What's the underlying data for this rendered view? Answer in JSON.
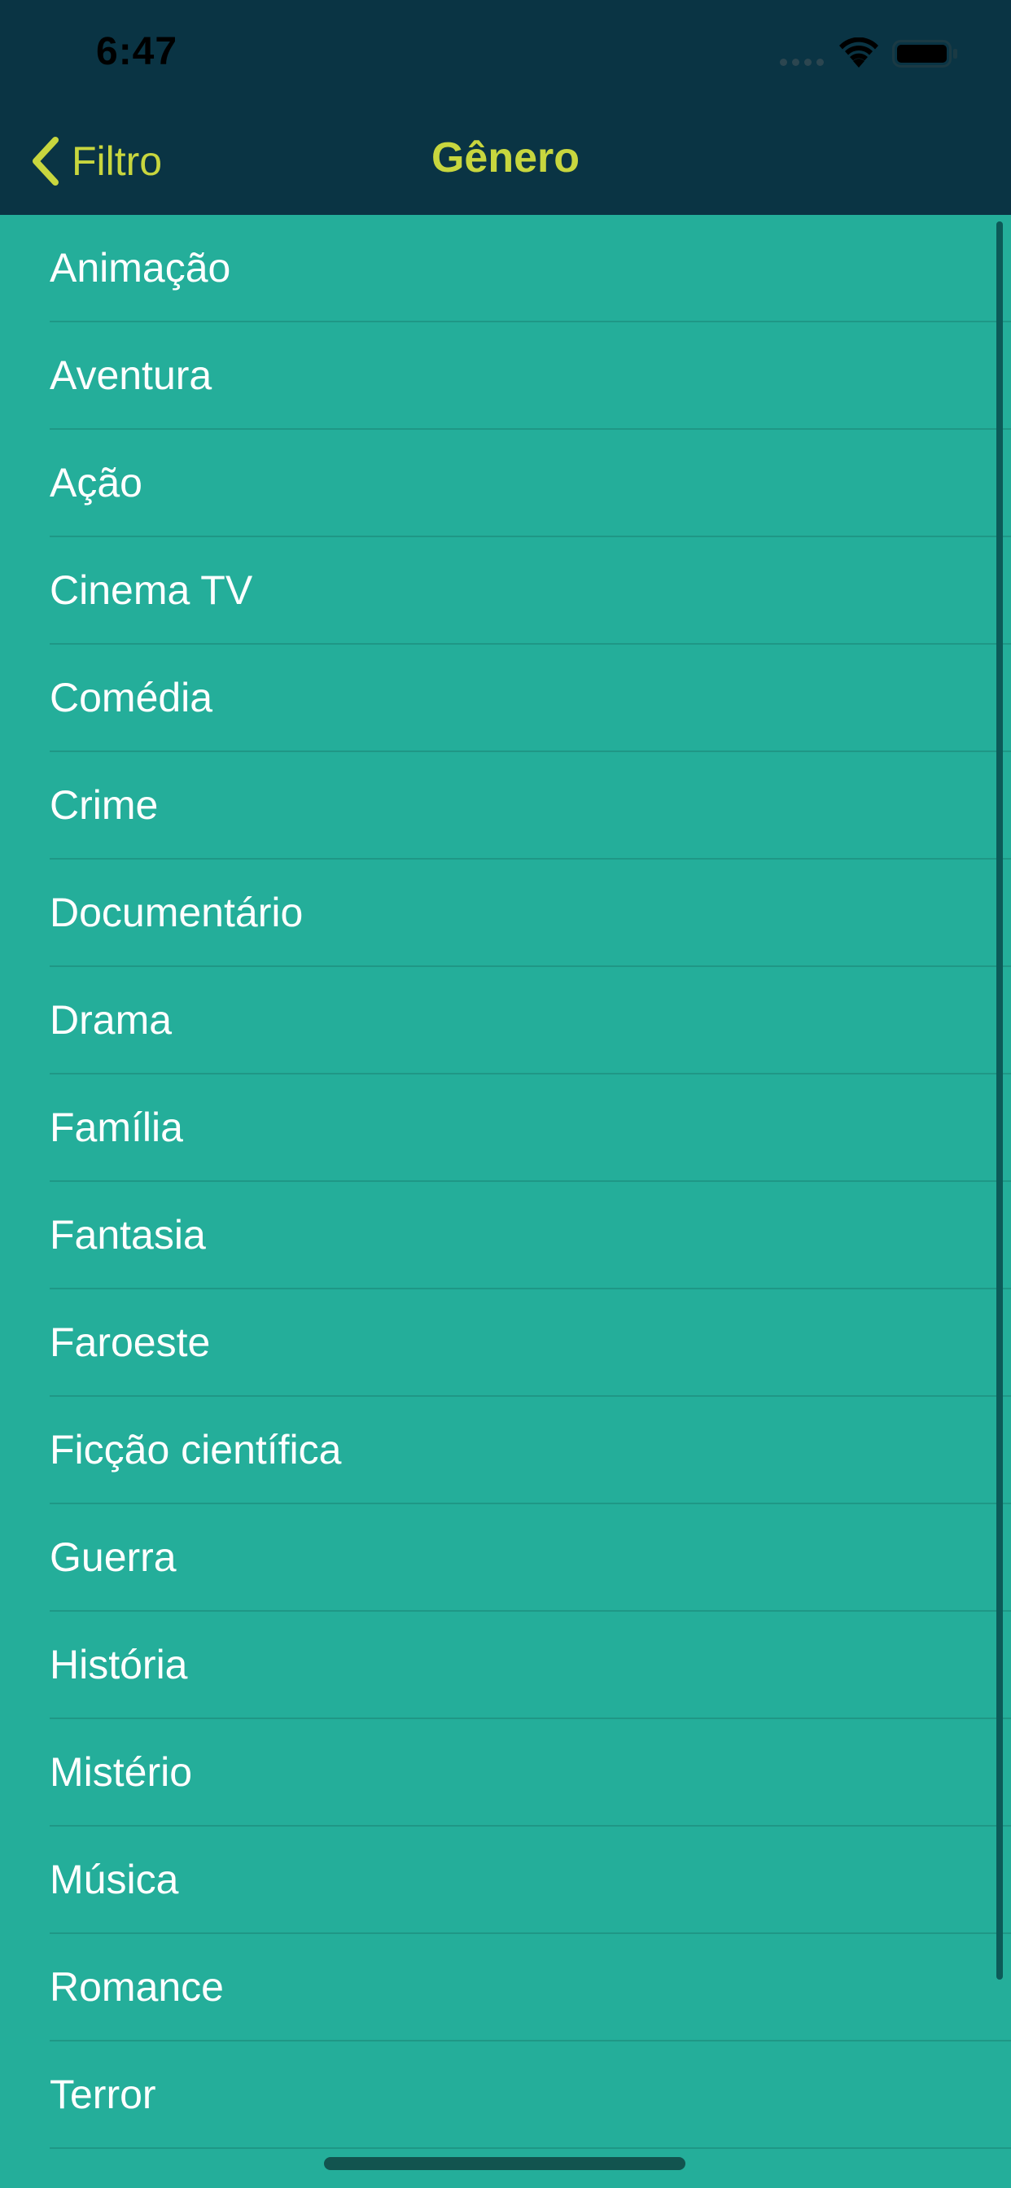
{
  "status_bar": {
    "time": "6:47"
  },
  "nav": {
    "back_label": "Filtro",
    "title": "Gênero"
  },
  "colors": {
    "header_background": "#0a3444",
    "list_background": "#24ae9a",
    "accent": "#c8d63e",
    "item_text": "#ffffff"
  },
  "genres": [
    "Animação",
    "Aventura",
    "Ação",
    "Cinema TV",
    "Comédia",
    "Crime",
    "Documentário",
    "Drama",
    "Família",
    "Fantasia",
    "Faroeste",
    "Ficção científica",
    "Guerra",
    "História",
    "Mistério",
    "Música",
    "Romance",
    "Terror"
  ]
}
